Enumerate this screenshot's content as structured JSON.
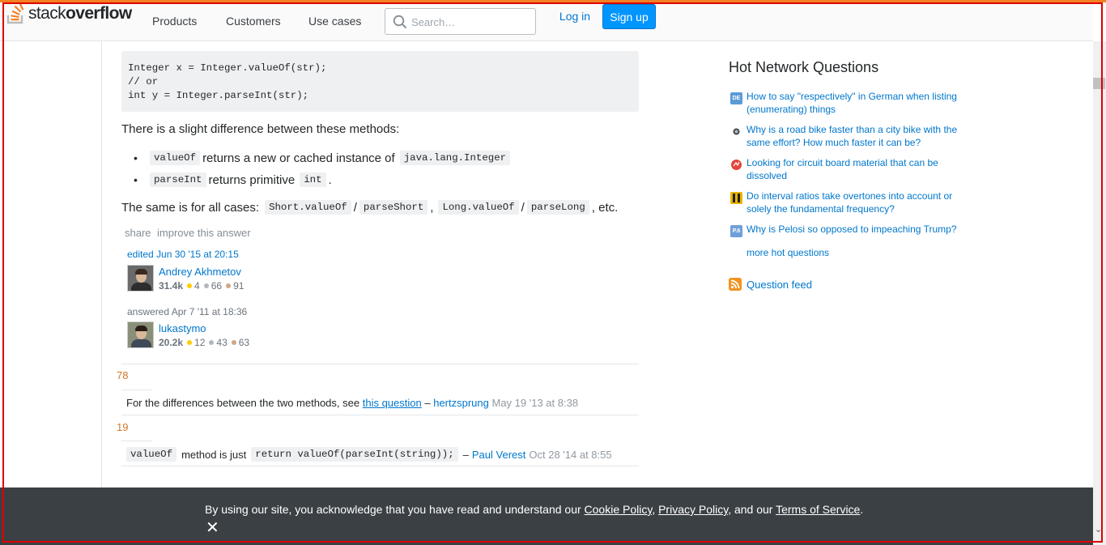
{
  "header": {
    "logo_prefix": "stack",
    "logo_suffix": "overflow",
    "nav": [
      "Products",
      "Customers",
      "Use cases"
    ],
    "search_placeholder": "Search…",
    "login_label": "Log in",
    "signup_label": "Sign up"
  },
  "answer": {
    "code": "Integer x = Integer.valueOf(str);\n// or\nint y = Integer.parseInt(str);",
    "intro": "There is a slight difference between these methods:",
    "bullets": [
      {
        "code1": "valueOf",
        "text": "returns a new or cached instance of",
        "code2": "java.lang.Integer"
      },
      {
        "code1": "parseInt",
        "text": "returns primitive",
        "code2": "int",
        "tail": "."
      }
    ],
    "same_prefix": "The same is for all cases:",
    "same_codes": [
      "Short.valueOf",
      "parseShort",
      "Long.valueOf",
      "parseLong"
    ],
    "same_sep": "/",
    "same_comma": ",",
    "same_tail": ", etc.",
    "share_label": "share",
    "improve_label": "improve this answer",
    "editor": {
      "action": "edited Jun 30 '15 at 20:15",
      "name": "Andrey Akhmetov",
      "rep": "31.4k",
      "gold": "4",
      "silver": "66",
      "bronze": "91"
    },
    "author": {
      "action": "answered Apr 7 '11 at 18:36",
      "name": "lukastymo",
      "rep": "20.2k",
      "gold": "12",
      "silver": "43",
      "bronze": "63"
    }
  },
  "comments": [
    {
      "score": "78",
      "text": "For the differences between the two methods, see",
      "link": "this question",
      "dash": "–",
      "user": "hertzsprung",
      "date": "May 19 '13 at 8:38"
    },
    {
      "score": "19",
      "code1": "valueOf",
      "text": "method is just",
      "code2": "return valueOf(parseInt(string));",
      "dash": "–",
      "user": "Paul Verest",
      "date": "Oct 28 '14 at 8:55"
    }
  ],
  "sidebar": {
    "title": "Hot Network Questions",
    "questions": [
      {
        "icon_label": "DE",
        "icon_color": "#5b9bd5",
        "text": "How to say \"respectively\" in German when listing (enumerating) things"
      },
      {
        "icon_label": "",
        "icon_color": "#4a4a4a",
        "text": "Why is a road bike faster than a city bike with the same effort? How much faster it can be?"
      },
      {
        "icon_label": "",
        "icon_color": "#e2453c",
        "text": "Looking for circuit board material that can be dissolved"
      },
      {
        "icon_label": "",
        "icon_color": "#e8b400",
        "text": "Do interval ratios take overtones into account or solely the fundamental frequency?"
      },
      {
        "icon_label": "P.6",
        "icon_color": "#6f9fd8",
        "text": "Why is Pelosi so opposed to impeaching Trump?"
      }
    ],
    "more_label": "more hot questions",
    "feed_label": "Question feed"
  },
  "cookie": {
    "prefix": "By using our site, you acknowledge that you have read and understand our",
    "cookie_policy": "Cookie Policy",
    "sep1": ",",
    "privacy_policy": "Privacy Policy",
    "sep2": ", and our",
    "terms": "Terms of Service",
    "end": ".",
    "close": "✕"
  }
}
